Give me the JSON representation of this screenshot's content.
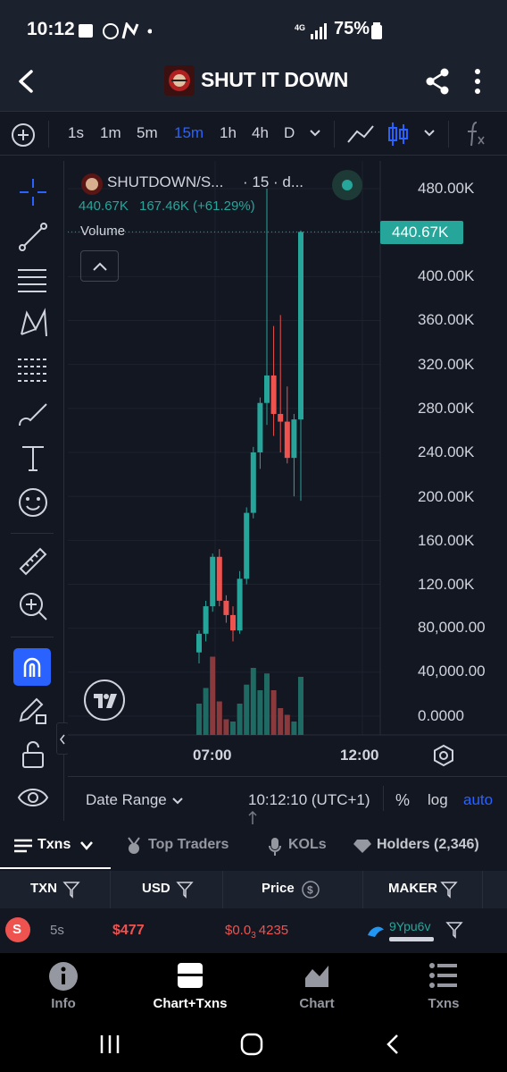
{
  "status": {
    "time": "10:12",
    "battery": "75%"
  },
  "header": {
    "title": "SHUT IT DOWN",
    "back_icon": "back-arrow-icon",
    "share_icon": "share-icon",
    "menu_icon": "more-vert-icon"
  },
  "toolbar": {
    "timeframes": [
      "1s",
      "1m",
      "5m",
      "15m",
      "1h",
      "4h",
      "D"
    ],
    "active_timeframe": "15m"
  },
  "legend": {
    "symbol": "SHUTDOWN/S...",
    "interval": "· 15 · d...",
    "price": "440.67K",
    "change": "167.46K (+61.29%)",
    "volume_label": "Volume"
  },
  "price_axis": {
    "labels": [
      "480.00K",
      "400.00K",
      "360.00K",
      "320.00K",
      "280.00K",
      "240.00K",
      "200.00K",
      "160.00K",
      "120.00K",
      "80,000.00",
      "40,000.00",
      "0.0000"
    ],
    "current_price_tag": "440.67K"
  },
  "time_axis": {
    "labels": [
      "07:00",
      "12:00"
    ]
  },
  "datebar": {
    "date_range": "Date Range",
    "clock": "10:12:10 (UTC+1)",
    "percent": "%",
    "log": "log",
    "auto": "auto"
  },
  "tabs": [
    {
      "label": "Txns"
    },
    {
      "label": "Top Traders"
    },
    {
      "label": "KOLs"
    },
    {
      "label": "Holders (2,346)"
    }
  ],
  "table": {
    "headers": [
      "TXN",
      "USD",
      "Price",
      "MAKER"
    ],
    "row": {
      "side": "S",
      "age": "5s",
      "usd": "$477",
      "price_prefix": "$0.0",
      "price_sub": "3",
      "price_suffix": "4235",
      "maker": "9Ypu6v"
    }
  },
  "bottom_nav": [
    {
      "label": "Info"
    },
    {
      "label": "Chart+Txns"
    },
    {
      "label": "Chart"
    },
    {
      "label": "Txns"
    }
  ],
  "colors": {
    "up": "#26a69a",
    "down": "#ef5350",
    "accent": "#2962ff",
    "bg": "#131722"
  },
  "chart_data": {
    "type": "candlestick",
    "xlabel": "",
    "ylabel": "",
    "ylim": [
      0,
      480000
    ],
    "x_ticks": [
      "07:00",
      "12:00"
    ],
    "candles": [
      {
        "o": 58000,
        "h": 78000,
        "l": 48000,
        "c": 75000
      },
      {
        "o": 75000,
        "h": 105000,
        "l": 68000,
        "c": 100000
      },
      {
        "o": 100000,
        "h": 148000,
        "l": 95000,
        "c": 145000
      },
      {
        "o": 145000,
        "h": 152000,
        "l": 100000,
        "c": 105000
      },
      {
        "o": 105000,
        "h": 110000,
        "l": 85000,
        "c": 92000
      },
      {
        "o": 92000,
        "h": 100000,
        "l": 68000,
        "c": 78000
      },
      {
        "o": 78000,
        "h": 132000,
        "l": 75000,
        "c": 125000
      },
      {
        "o": 125000,
        "h": 190000,
        "l": 120000,
        "c": 185000
      },
      {
        "o": 185000,
        "h": 245000,
        "l": 180000,
        "c": 240000
      },
      {
        "o": 240000,
        "h": 290000,
        "l": 225000,
        "c": 285000
      },
      {
        "o": 285000,
        "h": 480000,
        "l": 265000,
        "c": 310000
      },
      {
        "o": 310000,
        "h": 355000,
        "l": 255000,
        "c": 275000
      },
      {
        "o": 275000,
        "h": 365000,
        "l": 240000,
        "c": 268000
      },
      {
        "o": 268000,
        "h": 300000,
        "l": 230000,
        "c": 235000
      },
      {
        "o": 235000,
        "h": 275000,
        "l": 200000,
        "c": 270000
      },
      {
        "o": 270000,
        "h": 442000,
        "l": 196000,
        "c": 440670
      }
    ],
    "volumes": [
      {
        "v": 28,
        "up": true
      },
      {
        "v": 42,
        "up": true
      },
      {
        "v": 70,
        "up": false
      },
      {
        "v": 30,
        "up": false
      },
      {
        "v": 14,
        "up": false
      },
      {
        "v": 12,
        "up": true
      },
      {
        "v": 28,
        "up": true
      },
      {
        "v": 45,
        "up": true
      },
      {
        "v": 60,
        "up": true
      },
      {
        "v": 40,
        "up": true
      },
      {
        "v": 55,
        "up": true
      },
      {
        "v": 40,
        "up": false
      },
      {
        "v": 24,
        "up": false
      },
      {
        "v": 18,
        "up": false
      },
      {
        "v": 12,
        "up": true
      },
      {
        "v": 52,
        "up": true
      }
    ]
  }
}
